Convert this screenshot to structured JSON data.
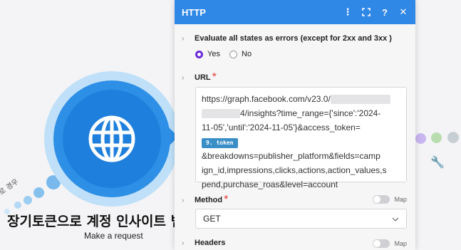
{
  "node": {
    "title": "장기토큰으로 계정 인사이트 범",
    "subtitle": "Make a request",
    "curve_text": "로 경우"
  },
  "panel": {
    "title": "HTTP",
    "header_icons": [
      "more-vertical-icon",
      "expand-icon",
      "help-icon",
      "close-icon"
    ],
    "evaluate_label": "Evaluate all states as errors (except for 2xx and 3xx )",
    "radio_yes": "Yes",
    "radio_no": "No",
    "selected_radio": "Yes",
    "url_label": "URL",
    "url": {
      "line1": "https://graph.facebook.com/v23.0/",
      "line2": "4/insights?time_range={'since':'2024-",
      "line3": "11-05','until':'2024-11-05'}&access_token=",
      "pill": "9. token",
      "line5": "&breakdowns=publisher_platform&fields=camp",
      "line6": "ign_id,impressions,clicks,actions,action_values,s",
      "line7": "pend,purchase_roas&level=account"
    },
    "method_label": "Method",
    "method_value": "GET",
    "map_label": "Map",
    "headers_label": "Headers"
  },
  "colors": {
    "header": "#2f87e6",
    "node": "#1f7fdd",
    "radio_selected": "#6b2bd9",
    "token_pill": "#3a8fc7"
  }
}
